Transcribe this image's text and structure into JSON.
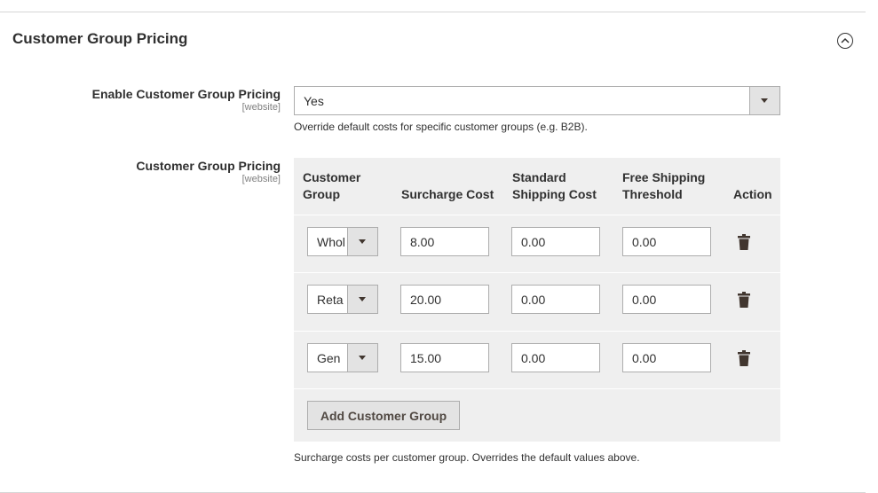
{
  "section": {
    "title": "Customer Group Pricing",
    "collapse_icon": "chevron-up-circle-icon"
  },
  "enable_field": {
    "label": "Enable Customer Group Pricing",
    "scope": "[website]",
    "value": "Yes",
    "note": "Override default costs for specific customer groups (e.g. B2B)."
  },
  "pricing_field": {
    "label": "Customer Group Pricing",
    "scope": "[website]",
    "note": "Surcharge costs per customer group. Overrides the default values above.",
    "headers": {
      "customer_group_line1": "Customer",
      "customer_group_line2": "Group",
      "surcharge": "Surcharge Cost",
      "standard_line1": "Standard",
      "standard_line2": "Shipping Cost",
      "free_line1": "Free Shipping",
      "free_line2": "Threshold",
      "action": "Action"
    },
    "rows": [
      {
        "group": "Whol",
        "surcharge": "8.00",
        "standard": "0.00",
        "free": "0.00"
      },
      {
        "group": "Reta",
        "surcharge": "20.00",
        "standard": "0.00",
        "free": "0.00"
      },
      {
        "group": "Gen",
        "surcharge": "15.00",
        "standard": "0.00",
        "free": "0.00"
      }
    ],
    "add_button": "Add Customer Group",
    "delete_icon": "trash-icon"
  }
}
